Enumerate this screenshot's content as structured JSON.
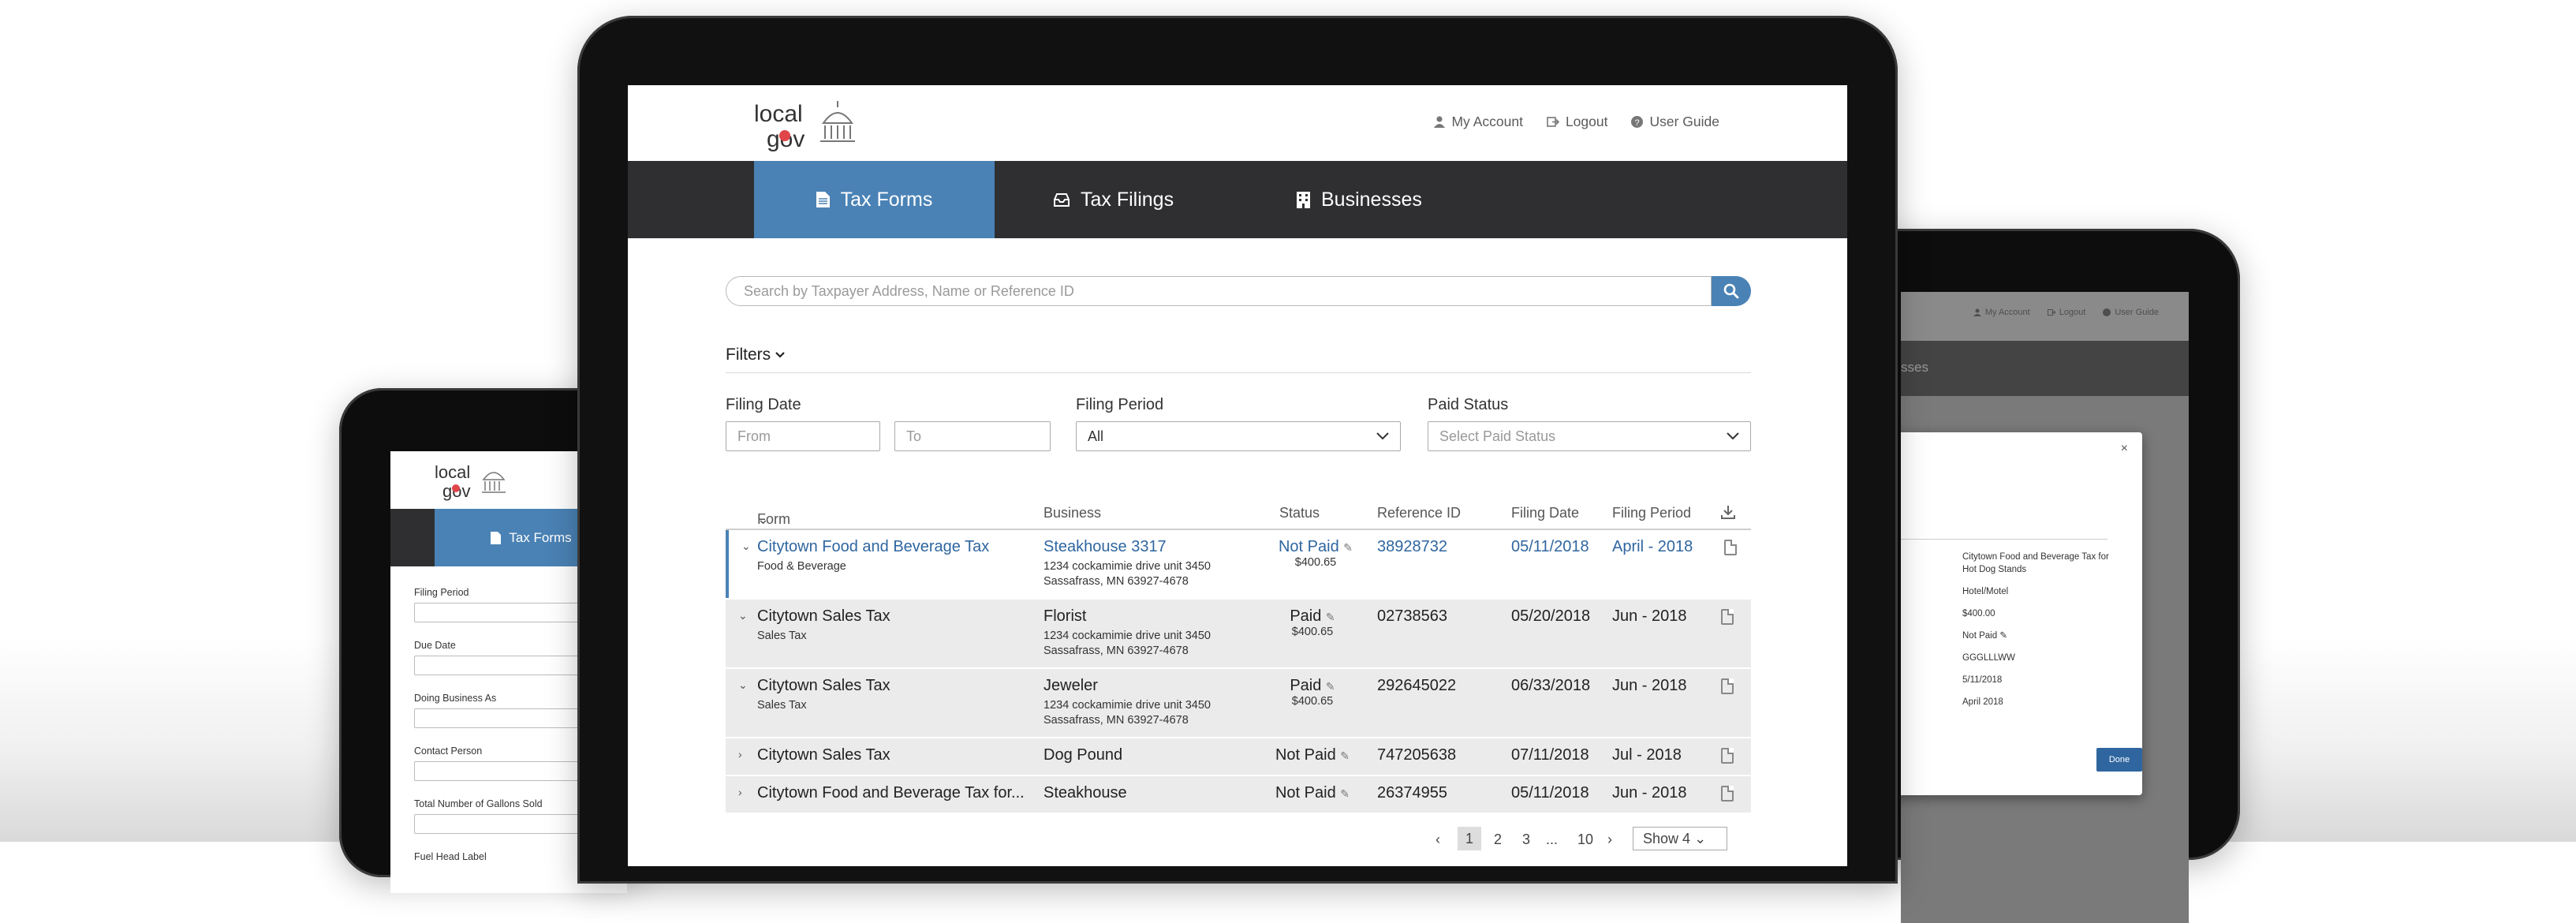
{
  "brand": {
    "logo_line1": "local",
    "logo_line2": "gov"
  },
  "header": {
    "my_account": "My Account",
    "logout": "Logout",
    "user_guide": "User Guide"
  },
  "nav": {
    "tax_forms": "Tax Forms",
    "tax_filings": "Tax Filings",
    "businesses": "Businesses"
  },
  "search": {
    "placeholder": "Search by Taxpayer Address, Name or Reference ID"
  },
  "filters": {
    "toggle_label": "Filters",
    "filing_date_label": "Filing Date",
    "from_placeholder": "From",
    "to_placeholder": "To",
    "filing_period_label": "Filing Period",
    "filing_period_value": "All",
    "paid_status_label": "Paid Status",
    "paid_status_placeholder": "Select Paid Status"
  },
  "table": {
    "columns": [
      "Form",
      "Business",
      "Status",
      "Reference ID",
      "Filing Date",
      "Filing Period"
    ],
    "rows": [
      {
        "form": "Citytown Food and Beverage Tax",
        "form_sub": "Food & Beverage",
        "business": "Steakhouse 3317",
        "addr1": "1234 cockamimie drive unit 3450",
        "addr2": "Sassafrass, MN 63927-4678",
        "status": "Not Paid",
        "amount": "$400.65",
        "ref": "38928732",
        "date": "05/11/2018",
        "period": "April - 2018"
      },
      {
        "form": "Citytown Sales Tax",
        "form_sub": "Sales Tax",
        "business": "Florist",
        "addr1": "1234 cockamimie drive unit 3450",
        "addr2": "Sassafrass, MN 63927-4678",
        "status": "Paid",
        "amount": "$400.65",
        "ref": "02738563",
        "date": "05/20/2018",
        "period": "Jun - 2018"
      },
      {
        "form": "Citytown Sales Tax",
        "form_sub": "Sales Tax",
        "business": "Jeweler",
        "addr1": "1234 cockamimie drive unit 3450",
        "addr2": "Sassafrass, MN 63927-4678",
        "status": "Paid",
        "amount": "$400.65",
        "ref": "292645022",
        "date": "06/33/2018",
        "period": "Jun - 2018"
      },
      {
        "form": "Citytown Sales Tax",
        "business": "Dog Pound",
        "status": "Not Paid",
        "ref": "747205638",
        "date": "07/11/2018",
        "period": "Jul - 2018"
      },
      {
        "form": "Citytown Food and Beverage Tax for...",
        "business": "Steakhouse",
        "status": "Not Paid",
        "ref": "26374955",
        "date": "05/11/2018",
        "period": "Jun - 2018"
      }
    ]
  },
  "pagination": {
    "prev": "‹",
    "page1": "1",
    "page2": "2",
    "page3": "3",
    "ellipsis": "...",
    "last": "10",
    "next": "›",
    "show": "Show 4"
  },
  "left_tablet": {
    "tab": "Tax Forms",
    "fields": [
      "Filing Period",
      "Due Date",
      "Doing Business As",
      "Contact Person",
      "Total Number of Gallons Sold",
      "Fuel Head Label"
    ]
  },
  "right_tablet": {
    "nav_partial": "sses",
    "modal_label_tail": "n",
    "values": [
      "Citytown Food and Beverage Tax for Hot Dog Stands",
      "Hotel/Motel",
      "$400.00",
      "Not Paid",
      "GGGLLLWW",
      "5/11/2018",
      "April 2018"
    ],
    "done": "Done",
    "close": "×"
  },
  "colors": {
    "accent": "#4a82b5",
    "link": "#2f66a0",
    "nav_bg": "#2f2f32"
  }
}
